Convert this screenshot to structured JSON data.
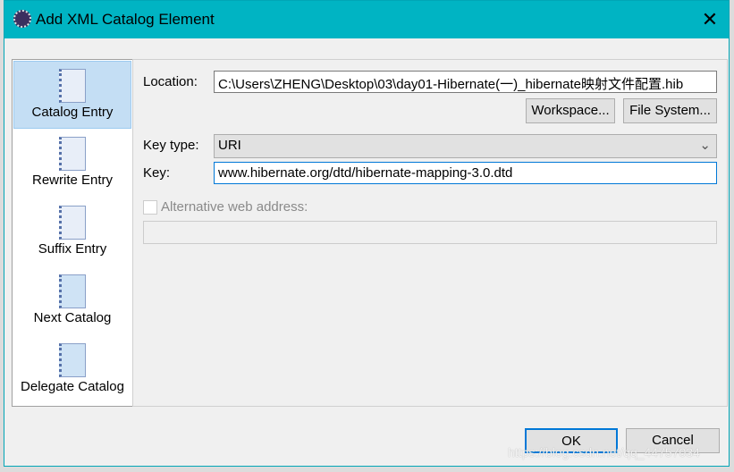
{
  "window": {
    "title": "Add XML Catalog Element",
    "close": "✕"
  },
  "sidebar": {
    "items": [
      {
        "label": "Catalog Entry",
        "selected": true
      },
      {
        "label": "Rewrite Entry"
      },
      {
        "label": "Suffix Entry"
      },
      {
        "label": "Next Catalog"
      },
      {
        "label": "Delegate Catalog"
      }
    ]
  },
  "form": {
    "location_label": "Location:",
    "location_value": "C:\\Users\\ZHENG\\Desktop\\03\\day01-Hibernate(一)_hibernate映射文件配置.hib",
    "workspace_button": "Workspace...",
    "filesystem_button": "File System...",
    "key_type_label": "Key type:",
    "key_type_value": "URI",
    "key_label": "Key:",
    "key_value": "www.hibernate.org/dtd/hibernate-mapping-3.0.dtd",
    "alt_web_label": "Alternative web address:",
    "alt_web_checked": false,
    "alt_web_value": ""
  },
  "footer": {
    "ok": "OK",
    "cancel": "Cancel"
  },
  "watermark": "https://blog.csdn.net/qq_44757034",
  "colors": {
    "titlebar": "#00b4c3",
    "selection": "#c4def4",
    "focus": "#0078d7"
  }
}
